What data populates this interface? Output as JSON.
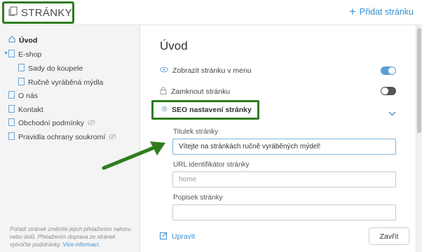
{
  "header": {
    "title": "STRÁNKY",
    "add_page_label": "Přidat stránku"
  },
  "sidebar": {
    "items": [
      {
        "label": "Úvod",
        "active": true
      },
      {
        "label": "E-shop",
        "expanded": true
      },
      {
        "label": "Sady do koupele"
      },
      {
        "label": "Ručně vyráběná mýdla"
      },
      {
        "label": "O nás"
      },
      {
        "label": "Kontakt"
      },
      {
        "label": "Obchodní podmínky",
        "hidden": true
      },
      {
        "label": "Pravidla ochrany soukromí",
        "hidden": true
      }
    ],
    "hint": "Pořadí stránek změníte jejich přetažením nahoru nebo dolů. Přetažením doprava ze stránek vytvoříte podstránky.",
    "hint_more": "Více informací."
  },
  "main": {
    "title": "Úvod",
    "show_in_menu_label": "Zobrazit stránku v menu",
    "show_in_menu": true,
    "lock_label": "Zamknout stránku",
    "lock": false,
    "seo_label": "SEO nastavení stránky",
    "page_title_label": "Titulek stránky",
    "page_title_value": "Vítejte na stránkách ručně vyráběných mýdel!",
    "url_label": "URL identifikátor stránky",
    "url_placeholder": "home",
    "description_label": "Popisek stránky",
    "description_value": "",
    "edit_label": "Upravit",
    "close_label": "Zavřít"
  },
  "colors": {
    "accent": "#3a8fd0",
    "highlight_frame": "#2e7d1f",
    "toggle_on": "#58a0d8"
  },
  "icons": {
    "header": "pages-icon",
    "add": "plus-icon",
    "home": "home-icon",
    "page": "page-icon",
    "hidden": "eye-slash-icon",
    "eye": "eye-icon",
    "lock": "lock-icon",
    "seo": "gear-icon",
    "edit": "edit-icon"
  }
}
